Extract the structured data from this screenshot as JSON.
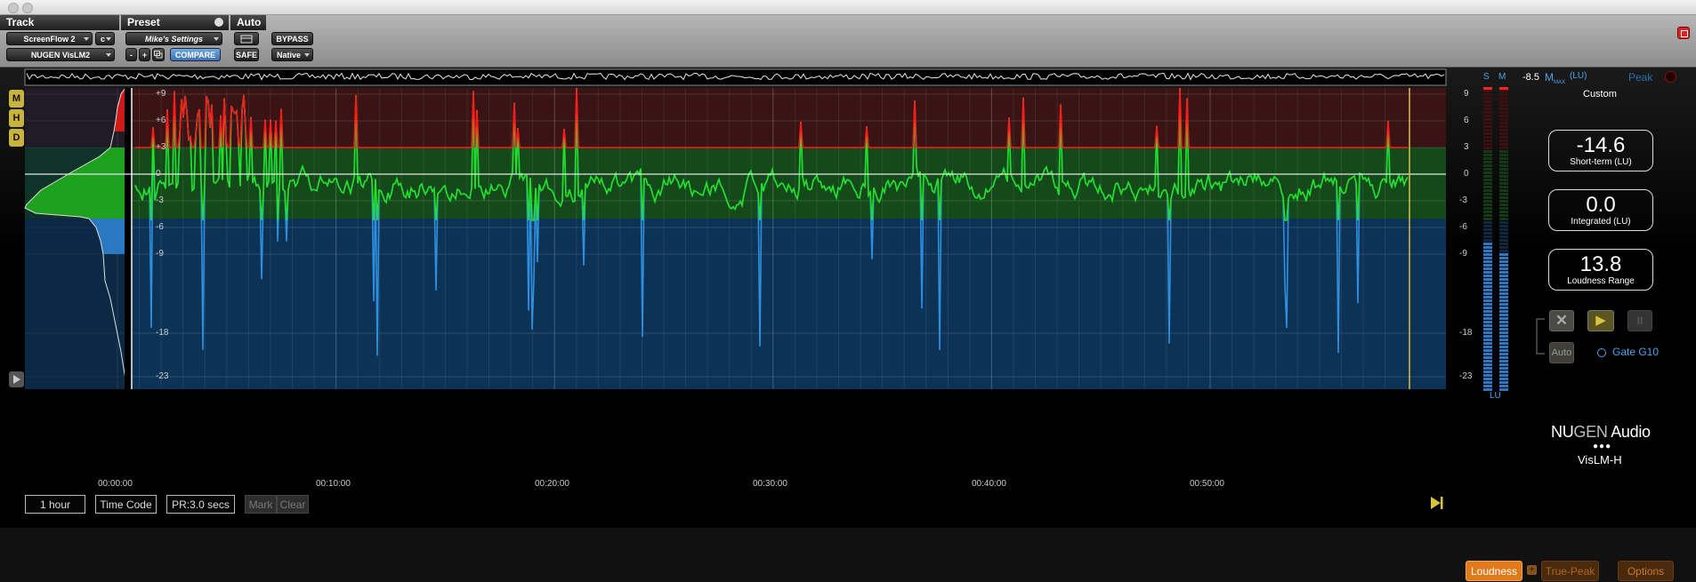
{
  "plugin_bar": {
    "track_header": "Track",
    "preset_header": "Preset",
    "auto_header": "Auto",
    "track_name": "ScreenFlow 2",
    "track_channel": "c",
    "insert_name": "NUGEN VisLM2",
    "preset_name": "Mike's Settings",
    "preset_minus": "-",
    "preset_plus": "+",
    "compare": "COMPARE",
    "safe": "SAFE",
    "bypass": "BYPASS",
    "native": "Native"
  },
  "meter": {
    "mode_buttons": [
      "M",
      "H",
      "D"
    ],
    "y_labels_left": [
      "+9",
      "+6",
      "+3",
      "0",
      "-3",
      "-6",
      "-9",
      "-18",
      "-23"
    ],
    "y_labels_right": [
      "9",
      "6",
      "3",
      "0",
      "-3",
      "-6",
      "-9",
      "-18",
      "-23"
    ],
    "time_labels": [
      "00:00:00",
      "00:10:00",
      "00:20:00",
      "00:30:00",
      "00:40:00",
      "00:50:00"
    ],
    "meter_s": "S",
    "meter_m": "M",
    "meter_unit": "LU"
  },
  "bottom": {
    "range": "1 hour",
    "timecode": "Time Code",
    "pr": "PR:3.0 secs",
    "mark": "Mark",
    "clear": "Clear"
  },
  "panel": {
    "max_value": "-8.5",
    "max_m": "M",
    "max_sub": "MAX",
    "max_unit": "(LU)",
    "peak": "Peak",
    "preset_mode": "Custom",
    "readouts": [
      {
        "value": "-14.6",
        "caption": "Short-term (LU)"
      },
      {
        "value": "0.0",
        "caption": "Integrated (LU)"
      },
      {
        "value": "13.8",
        "caption": "Loudness Range"
      }
    ],
    "auto": "Auto",
    "gate": "Gate G10",
    "brand_left": "NU",
    "brand_mid": "GEN",
    "brand_right": " Audio",
    "product": "VisLM-H",
    "loudness_tab": "Loudness",
    "truepeak_tab": "True-Peak",
    "options": "Options"
  },
  "colors": {
    "red_zone": "#3a1414",
    "green_zone": "#144a1a",
    "blue_zone": "#0c3356",
    "red_trace": "#ff1a1a",
    "green_trace": "#22e022",
    "blue_trace": "#2e8fe0",
    "accent_orange": "#e07b1c",
    "accent_yellow": "#d8c23e"
  }
}
